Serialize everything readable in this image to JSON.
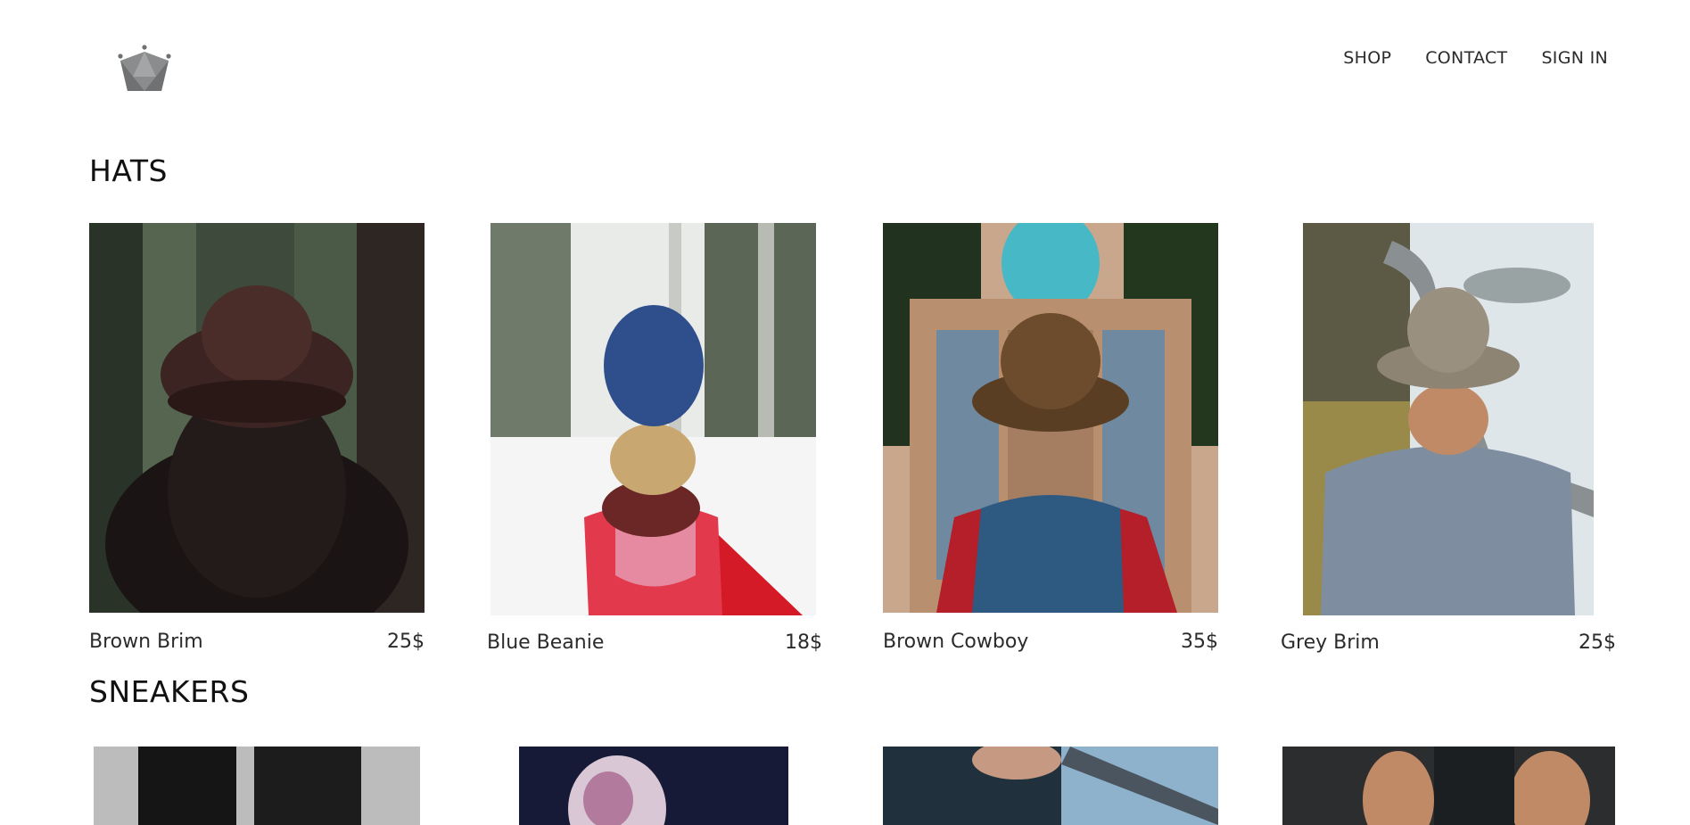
{
  "nav": {
    "shop": "SHOP",
    "contact": "CONTACT",
    "sign_in": "SIGN IN"
  },
  "sections": {
    "hats": {
      "title": "HATS",
      "items": [
        {
          "name": "Brown Brim",
          "price": "25$"
        },
        {
          "name": "Blue Beanie",
          "price": "18$"
        },
        {
          "name": "Brown Cowboy",
          "price": "35$"
        },
        {
          "name": "Grey Brim",
          "price": "25$"
        }
      ]
    },
    "sneakers": {
      "title": "SNEAKERS"
    }
  },
  "colors": {
    "text": "#111111",
    "nav_text": "#2b2b2b",
    "logo": "#808282"
  },
  "icons": {
    "logo": "crown-icon"
  }
}
